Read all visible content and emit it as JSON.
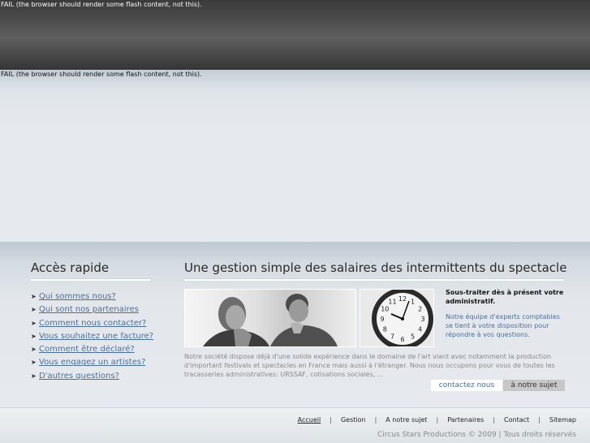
{
  "flash": {
    "top_fail": "FAIL (the browser should render some flash content, not this).",
    "banner_fail": "FAIL (the browser should render some flash content, not this)."
  },
  "quick_access": {
    "title": "Accès rapide",
    "links": [
      "Qui sommes nous?",
      "Qui sont nos partenaires",
      "Comment nous contacter?",
      "Vous souhaitez une facture?",
      "Comment être déclaré?",
      "Vous engagez un artistes?",
      "D'autres questions?"
    ]
  },
  "main": {
    "title": "Une gestion simple des salaires des intermittents du spectacle",
    "side_title": "Sous-traiter dès à présent votre administratif.",
    "side_desc": "Notre équipe d'experts comptables se tient à votre disposition pour répondre à vos questions.",
    "body": "Notre société dispose déjà d'une solide expérience dans le domaine de l'art viant avec notamment la production d'important festivals et spectacles en France mais aussi à l'étranger. Nous nous occupons pour vous de toutes les tracasseries administratives: URSSAF, cotisations sociales, ...",
    "contact_button": "contactez nous",
    "about_button": "à notre sujet"
  },
  "clock_numbers": [
    "12",
    "1",
    "2",
    "3",
    "4",
    "5",
    "6",
    "7",
    "8",
    "9",
    "10",
    "11"
  ],
  "footer": {
    "nav": [
      "Accueil",
      "Gestion",
      "A notre sujet",
      "Partenaires",
      "Contact",
      "Sitemap"
    ],
    "separator": "|",
    "copyright": "Circus Stars Productions © 2009 | Tous droits réservés"
  },
  "colors": {
    "link": "#4a6f99",
    "header_dark": "#3a3a3a",
    "button_grey": "#c7c7c7"
  }
}
